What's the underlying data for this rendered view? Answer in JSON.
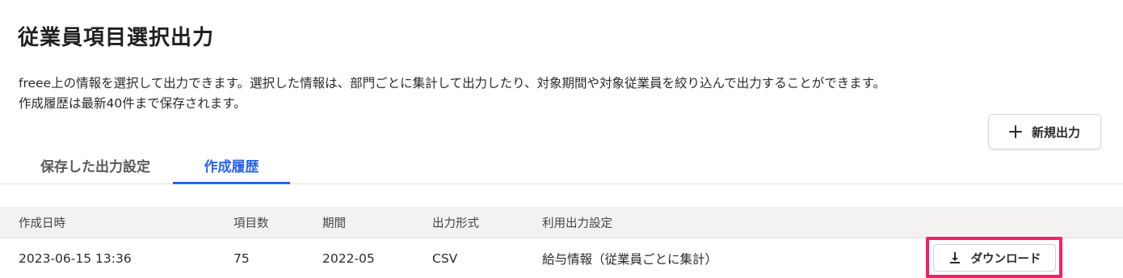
{
  "page": {
    "title": "従業員項目選択出力",
    "description_line1": "freee上の情報を選択して出力できます。選択した情報は、部門ごとに集計して出力したり、対象期間や対象従業員を絞り込んで出力することができます。",
    "description_line2": "作成履歴は最新40件まで保存されます。"
  },
  "new_output_button": {
    "label": "新規出力",
    "icon": "plus-icon"
  },
  "tabs": [
    {
      "label": "保存した出力設定",
      "active": false
    },
    {
      "label": "作成履歴",
      "active": true
    }
  ],
  "table": {
    "columns": [
      "作成日時",
      "項目数",
      "期間",
      "出力形式",
      "利用出力設定"
    ],
    "rows": [
      {
        "created_at": "2023-06-15 13:36",
        "item_count": "75",
        "period": "2022-05",
        "format": "CSV",
        "setting": "給与情報（従業員ごとに集計）",
        "download_label": "ダウンロード",
        "download_icon": "download-icon"
      }
    ]
  },
  "colors": {
    "accent": "#2864f0",
    "highlight": "#f0206a",
    "header_bg": "#f4f2f1"
  }
}
